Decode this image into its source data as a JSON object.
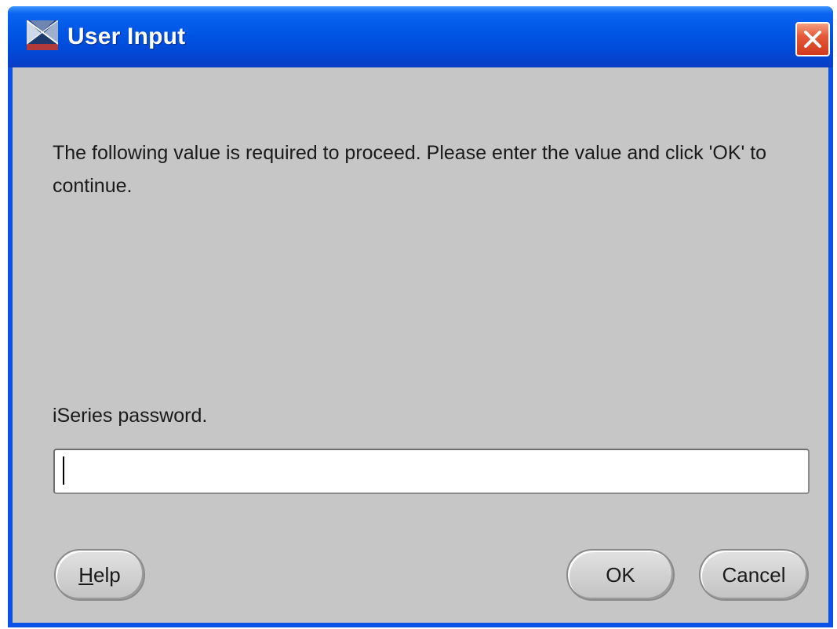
{
  "window": {
    "title": "User Input",
    "title_icon": "oracle-app-icon",
    "close_icon": "close-icon"
  },
  "message": "The following value is required to proceed. Please enter the value and click 'OK' to continue.",
  "field": {
    "label": "iSeries password.",
    "value": "",
    "placeholder": ""
  },
  "buttons": {
    "help": {
      "mnemonic": "H",
      "rest": "elp"
    },
    "ok": "OK",
    "cancel": "Cancel"
  },
  "colors": {
    "titlebar": "#0055e5",
    "client_background": "#c6c6c6",
    "close_button": "#e6583a"
  }
}
